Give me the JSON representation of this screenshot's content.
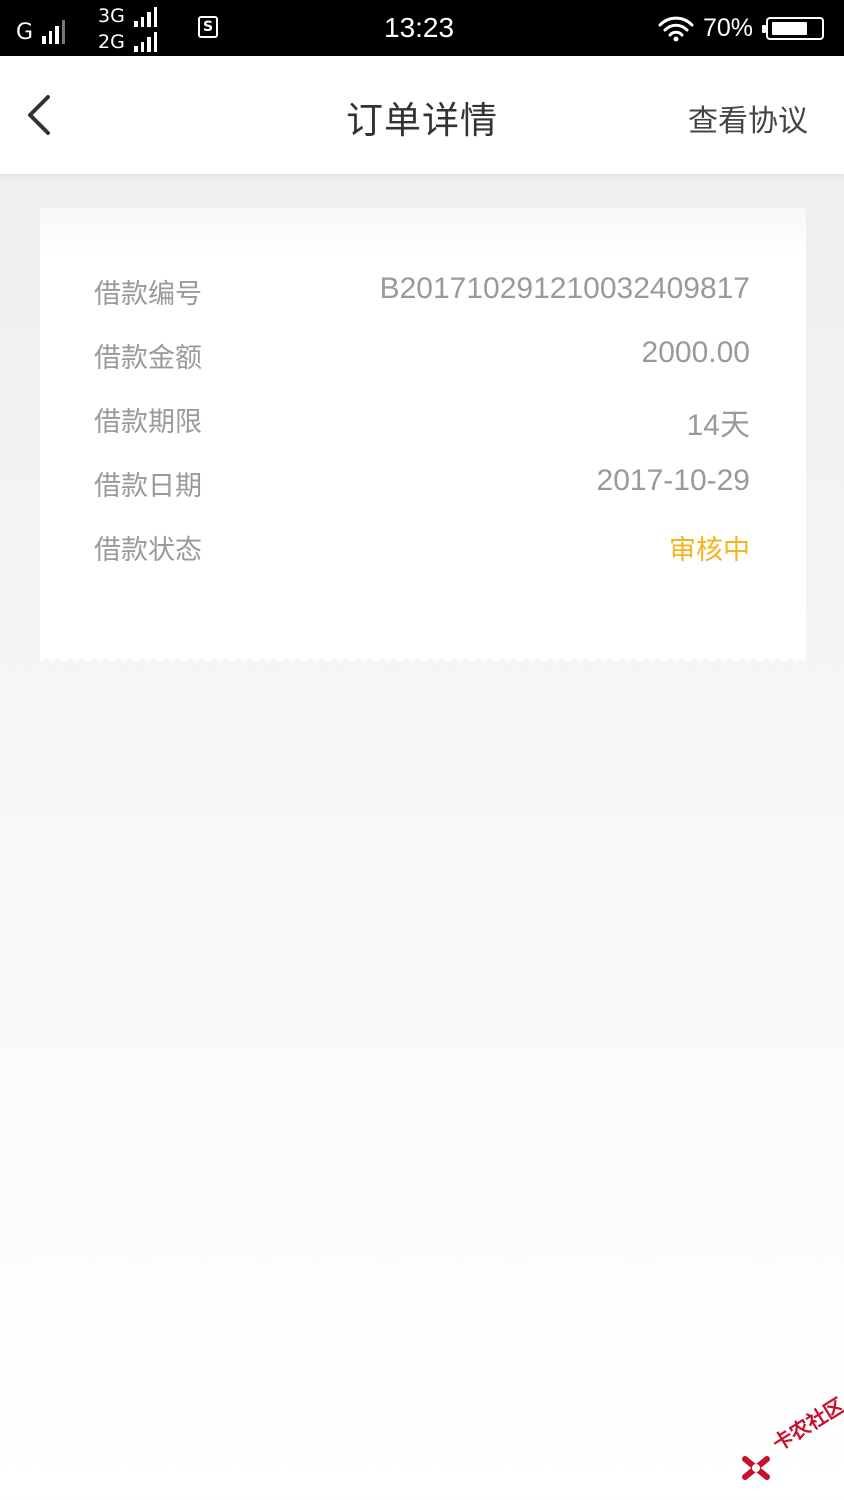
{
  "status_bar": {
    "network_1": "G",
    "network_2": "3G",
    "network_3": "2G",
    "sim_badge": "S",
    "time": "13:23",
    "battery": "70%",
    "battery_level": 0.7,
    "icons": [
      "signal-icon",
      "sim-icon",
      "wifi-icon",
      "battery-icon"
    ]
  },
  "nav": {
    "back_icon": "chevron-left-icon",
    "title": "订单详情",
    "action": "查看协议"
  },
  "order": {
    "rows": [
      {
        "label": "借款编号",
        "value": "B20171029121003240981 7"
      },
      {
        "label": "借款金额",
        "value": "2000.00"
      },
      {
        "label": "借款期限",
        "value": "14天"
      },
      {
        "label": "借款日期",
        "value": "2017-10-29"
      },
      {
        "label": "借款状态",
        "value": "审核中"
      }
    ]
  },
  "watermark": {
    "text": "卡农社区"
  },
  "colors": {
    "status_pending": "#f5b320",
    "label_gray": "#9a9a9a",
    "title": "#333333",
    "watermark_red": "#c8102e"
  }
}
